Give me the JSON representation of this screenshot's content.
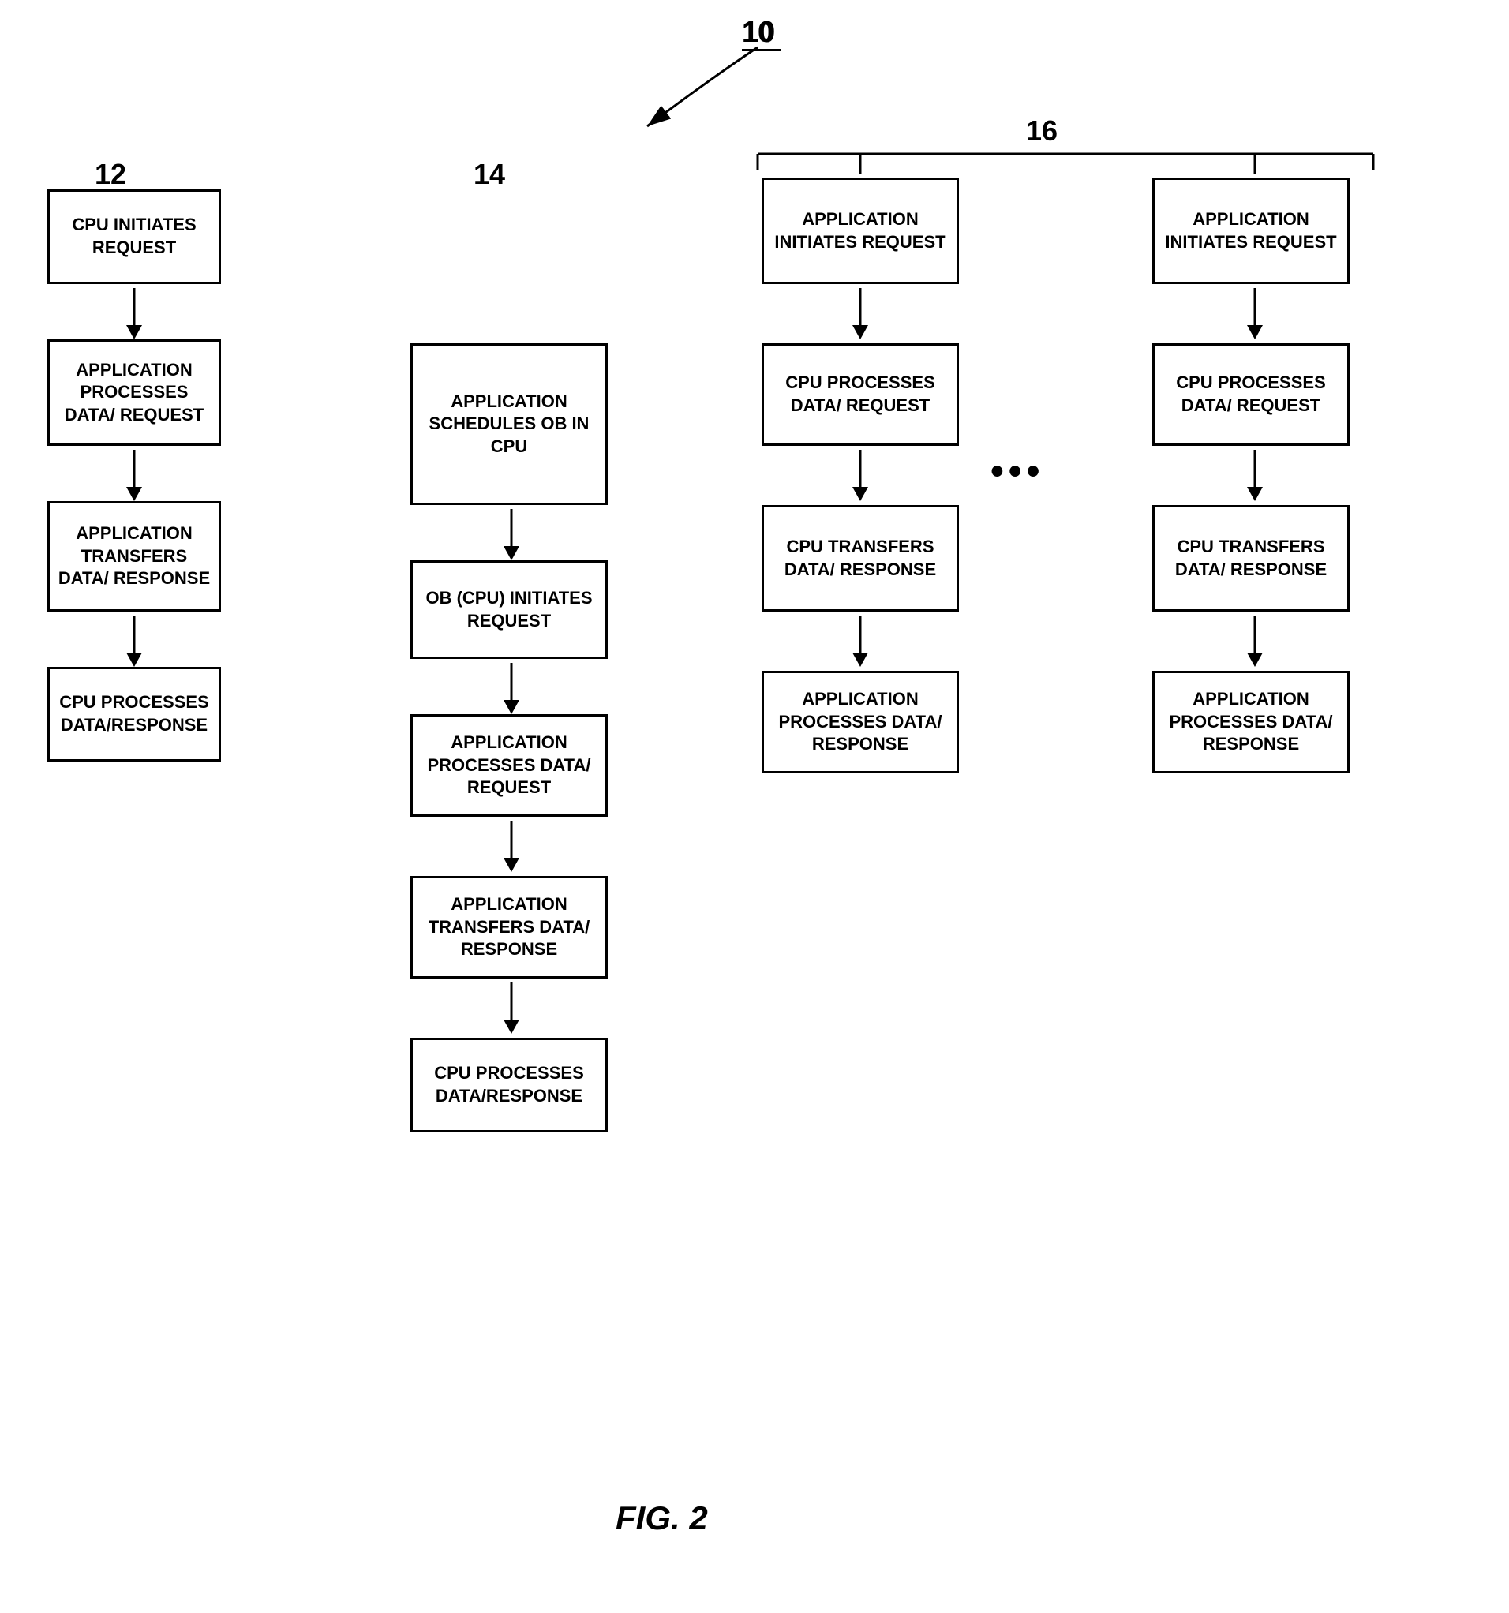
{
  "diagram": {
    "title": "10",
    "fig_label": "FIG. 2",
    "columns": {
      "col12": {
        "label": "12",
        "boxes": [
          "CPU INITIATES REQUEST",
          "APPLICATION PROCESSES DATA/ REQUEST",
          "APPLICATION TRANSFERS DATA/ RESPONSE",
          "CPU PROCESSES DATA/RESPONSE"
        ]
      },
      "col14": {
        "label": "14",
        "boxes": [
          "APPLICATION SCHEDULES OB IN CPU",
          "OB (CPU) INITIATES REQUEST",
          "APPLICATION PROCESSES DATA/ REQUEST",
          "APPLICATION TRANSFERS DATA/ RESPONSE",
          "CPU PROCESSES DATA/RESPONSE"
        ]
      },
      "col16": {
        "label": "16",
        "col_left": {
          "boxes": [
            "APPLICATION INITIATES REQUEST",
            "CPU PROCESSES DATA/ REQUEST",
            "CPU TRANSFERS DATA/ RESPONSE",
            "APPLICATION PROCESSES DATA/ RESPONSE"
          ]
        },
        "col_right": {
          "boxes": [
            "APPLICATION INITIATES REQUEST",
            "CPU PROCESSES DATA/ REQUEST",
            "CPU TRANSFERS DATA/ RESPONSE",
            "APPLICATION PROCESSES DATA/ RESPONSE"
          ]
        }
      }
    }
  }
}
